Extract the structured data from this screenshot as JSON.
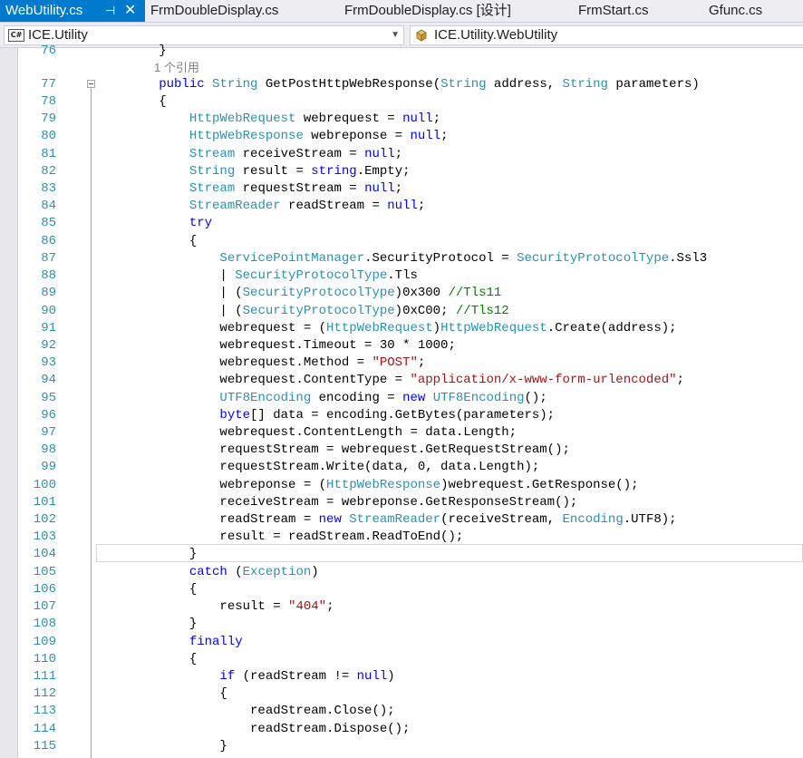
{
  "tabs": [
    {
      "label": "WebUtility.cs",
      "active": true
    },
    {
      "label": "FrmDoubleDisplay.cs",
      "active": false
    },
    {
      "label": "FrmDoubleDisplay.cs [设计]",
      "active": false
    },
    {
      "label": "FrmStart.cs",
      "active": false
    },
    {
      "label": "Gfunc.cs",
      "active": false
    }
  ],
  "tab_pin_glyph": "⊣",
  "tab_close_glyph": "✕",
  "nav": {
    "project_combo": "ICE.Utility",
    "project_icon_text": "C#",
    "type_combo": "ICE.Utility.WebUtility"
  },
  "colors": {
    "keyword": "#0000ff",
    "type": "#2b91af",
    "string": "#a31515",
    "comment": "#008000",
    "line_number": "#2b91af",
    "active_tab": "#007acc"
  },
  "editor": {
    "reference_hint": "1 个引用",
    "line_numbers": [
      "76",
      "77",
      "78",
      "79",
      "80",
      "81",
      "82",
      "83",
      "84",
      "85",
      "86",
      "87",
      "88",
      "89",
      "90",
      "91",
      "92",
      "93",
      "94",
      "95",
      "96",
      "97",
      "98",
      "99",
      "100",
      "101",
      "102",
      "103",
      "104",
      "105",
      "106",
      "107",
      "108",
      "109",
      "110",
      "111",
      "112",
      "113",
      "114",
      "115"
    ],
    "lines": [
      [
        [
          "",
          "        }"
        ]
      ],
      [
        [
          "",
          "        "
        ],
        [
          "kw",
          "public"
        ],
        [
          "",
          " "
        ],
        [
          "ty",
          "String"
        ],
        [
          "",
          " GetPostHttpWebResponse("
        ],
        [
          "ty",
          "String"
        ],
        [
          "",
          " address, "
        ],
        [
          "ty",
          "String"
        ],
        [
          "",
          " parameters)"
        ]
      ],
      [
        [
          "",
          "        {"
        ]
      ],
      [
        [
          "",
          "            "
        ],
        [
          "ty",
          "HttpWebRequest"
        ],
        [
          "",
          " webrequest = "
        ],
        [
          "kw",
          "null"
        ],
        [
          "",
          ";"
        ]
      ],
      [
        [
          "",
          "            "
        ],
        [
          "ty",
          "HttpWebResponse"
        ],
        [
          "",
          " webreponse = "
        ],
        [
          "kw",
          "null"
        ],
        [
          "",
          ";"
        ]
      ],
      [
        [
          "",
          "            "
        ],
        [
          "ty",
          "Stream"
        ],
        [
          "",
          " receiveStream = "
        ],
        [
          "kw",
          "null"
        ],
        [
          "",
          ";"
        ]
      ],
      [
        [
          "",
          "            "
        ],
        [
          "ty",
          "String"
        ],
        [
          "",
          " result = "
        ],
        [
          "kw",
          "string"
        ],
        [
          "",
          ".Empty;"
        ]
      ],
      [
        [
          "",
          "            "
        ],
        [
          "ty",
          "Stream"
        ],
        [
          "",
          " requestStream = "
        ],
        [
          "kw",
          "null"
        ],
        [
          "",
          ";"
        ]
      ],
      [
        [
          "",
          "            "
        ],
        [
          "ty",
          "StreamReader"
        ],
        [
          "",
          " readStream = "
        ],
        [
          "kw",
          "null"
        ],
        [
          "",
          ";"
        ]
      ],
      [
        [
          "",
          "            "
        ],
        [
          "kw",
          "try"
        ]
      ],
      [
        [
          "",
          "            {"
        ]
      ],
      [
        [
          "",
          "                "
        ],
        [
          "ty",
          "ServicePointManager"
        ],
        [
          "",
          ".SecurityProtocol = "
        ],
        [
          "ty",
          "SecurityProtocolType"
        ],
        [
          "",
          ".Ssl3"
        ]
      ],
      [
        [
          "",
          "                | "
        ],
        [
          "ty",
          "SecurityProtocolType"
        ],
        [
          "",
          ".Tls"
        ]
      ],
      [
        [
          "",
          "                | ("
        ],
        [
          "ty",
          "SecurityProtocolType"
        ],
        [
          "",
          ")0x300 "
        ],
        [
          "cm",
          "//Tls11"
        ]
      ],
      [
        [
          "",
          "                | ("
        ],
        [
          "ty",
          "SecurityProtocolType"
        ],
        [
          "",
          ")0xC00; "
        ],
        [
          "cm",
          "//Tls12"
        ]
      ],
      [
        [
          "",
          "                webrequest = ("
        ],
        [
          "ty",
          "HttpWebRequest"
        ],
        [
          "",
          ")"
        ],
        [
          "ty",
          "HttpWebRequest"
        ],
        [
          "",
          ".Create(address);"
        ]
      ],
      [
        [
          "",
          "                webrequest.Timeout = 30 * 1000;"
        ]
      ],
      [
        [
          "",
          "                webrequest.Method = "
        ],
        [
          "st",
          "\"POST\""
        ],
        [
          "",
          ";"
        ]
      ],
      [
        [
          "",
          "                webrequest.ContentType = "
        ],
        [
          "st",
          "\"application/x-www-form-urlencoded\""
        ],
        [
          "",
          ";"
        ]
      ],
      [
        [
          "",
          "                "
        ],
        [
          "ty",
          "UTF8Encoding"
        ],
        [
          "",
          " encoding = "
        ],
        [
          "kw",
          "new"
        ],
        [
          "",
          " "
        ],
        [
          "ty",
          "UTF8Encoding"
        ],
        [
          "",
          "();"
        ]
      ],
      [
        [
          "",
          "                "
        ],
        [
          "kw",
          "byte"
        ],
        [
          "",
          "[] data = encoding.GetBytes(parameters);"
        ]
      ],
      [
        [
          "",
          "                webrequest.ContentLength = data.Length;"
        ]
      ],
      [
        [
          "",
          "                requestStream = webrequest.GetRequestStream();"
        ]
      ],
      [
        [
          "",
          "                requestStream.Write(data, 0, data.Length);"
        ]
      ],
      [
        [
          "",
          "                webreponse = ("
        ],
        [
          "ty",
          "HttpWebResponse"
        ],
        [
          "",
          ")webrequest.GetResponse();"
        ]
      ],
      [
        [
          "",
          "                receiveStream = webreponse.GetResponseStream();"
        ]
      ],
      [
        [
          "",
          "                readStream = "
        ],
        [
          "kw",
          "new"
        ],
        [
          "",
          " "
        ],
        [
          "ty",
          "StreamReader"
        ],
        [
          "",
          "(receiveStream, "
        ],
        [
          "ty",
          "Encoding"
        ],
        [
          "",
          ".UTF8);"
        ]
      ],
      [
        [
          "",
          "                result = readStream.ReadToEnd();"
        ]
      ],
      [
        [
          "",
          "            }"
        ]
      ],
      [
        [
          "",
          "            "
        ],
        [
          "kw",
          "catch"
        ],
        [
          "",
          " ("
        ],
        [
          "ty",
          "Exception"
        ],
        [
          "",
          ")"
        ]
      ],
      [
        [
          "",
          "            {"
        ]
      ],
      [
        [
          "",
          "                result = "
        ],
        [
          "st",
          "\"404\""
        ],
        [
          "",
          ";"
        ]
      ],
      [
        [
          "",
          "            }"
        ]
      ],
      [
        [
          "",
          "            "
        ],
        [
          "kw",
          "finally"
        ]
      ],
      [
        [
          "",
          "            {"
        ]
      ],
      [
        [
          "",
          "                "
        ],
        [
          "kw",
          "if"
        ],
        [
          "",
          " (readStream != "
        ],
        [
          "kw",
          "null"
        ],
        [
          "",
          ")"
        ]
      ],
      [
        [
          "",
          "                {"
        ]
      ],
      [
        [
          "",
          "                    readStream.Close();"
        ]
      ],
      [
        [
          "",
          "                    readStream.Dispose();"
        ]
      ],
      [
        [
          "",
          "                }"
        ]
      ]
    ]
  }
}
